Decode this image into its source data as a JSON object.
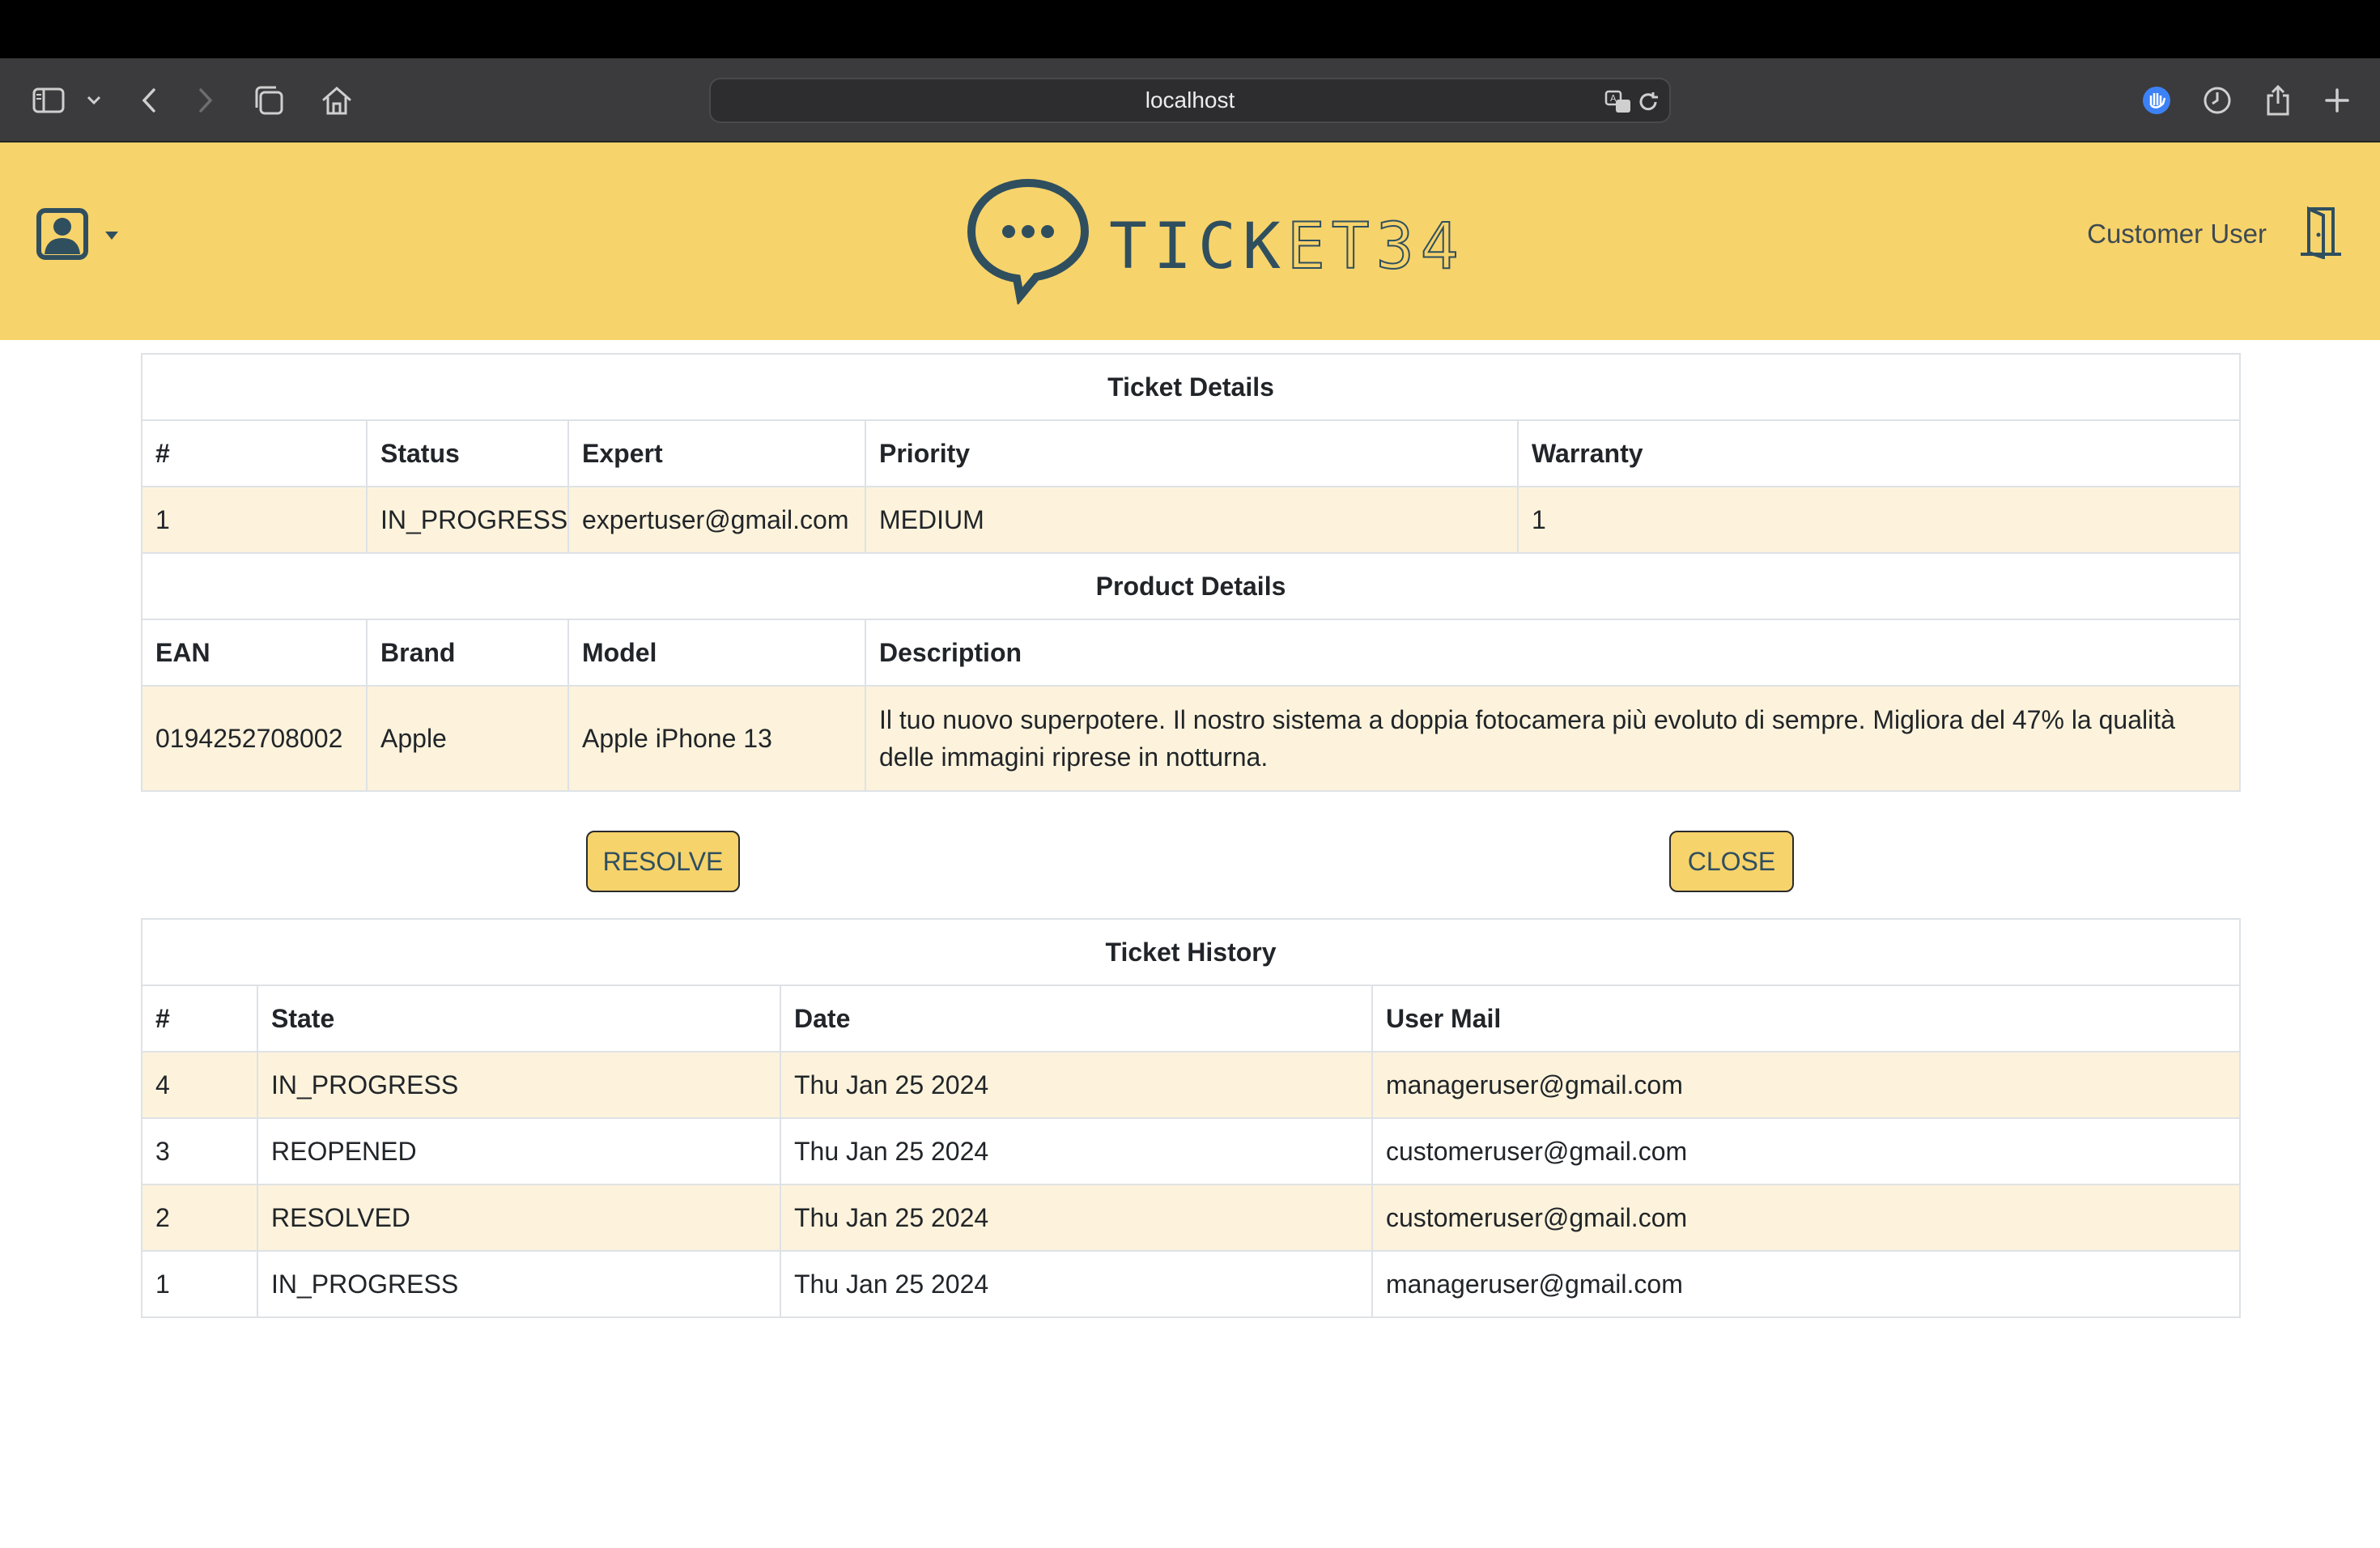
{
  "browser": {
    "url": "localhost",
    "icons": [
      "sidebar-icon",
      "chevron-down-icon",
      "back-icon",
      "forward-icon",
      "tabs-icon",
      "home-icon",
      "translate-icon",
      "reload-icon",
      "shield-icon",
      "history-icon",
      "share-icon",
      "plus-icon"
    ]
  },
  "header": {
    "logo_text_solid": "TICK",
    "logo_text_outline": "ET34",
    "user_name": "Customer User",
    "colors": {
      "brand": "#f7d36b",
      "ink": "#2f4f5f"
    }
  },
  "ticket_details": {
    "title": "Ticket Details",
    "columns": [
      "#",
      "Status",
      "Expert",
      "Priority",
      "Warranty"
    ],
    "row": [
      "1",
      "IN_PROGRESS",
      "expertuser@gmail.com",
      "MEDIUM",
      "1"
    ]
  },
  "product_details": {
    "title": "Product Details",
    "columns": [
      "EAN",
      "Brand",
      "Model",
      "Description"
    ],
    "row": [
      "0194252708002",
      "Apple",
      "Apple iPhone 13",
      "Il tuo nuovo superpotere. Il nostro sistema a doppia fotocamera più evoluto di sempre. Migliora del 47% la qualità delle immagini riprese in notturna."
    ]
  },
  "actions": {
    "resolve": "RESOLVE",
    "close": "CLOSE"
  },
  "ticket_history": {
    "title": "Ticket History",
    "columns": [
      "#",
      "State",
      "Date",
      "User Mail"
    ],
    "rows": [
      [
        "4",
        "IN_PROGRESS",
        "Thu Jan 25 2024",
        "manageruser@gmail.com"
      ],
      [
        "3",
        "REOPENED",
        "Thu Jan 25 2024",
        "customeruser@gmail.com"
      ],
      [
        "2",
        "RESOLVED",
        "Thu Jan 25 2024",
        "customeruser@gmail.com"
      ],
      [
        "1",
        "IN_PROGRESS",
        "Thu Jan 25 2024",
        "manageruser@gmail.com"
      ]
    ]
  }
}
